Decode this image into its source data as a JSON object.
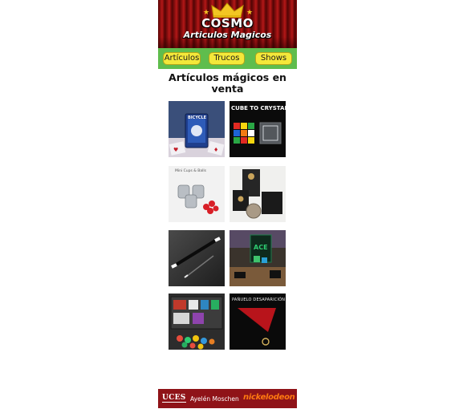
{
  "header": {
    "brand_title": "COSMO",
    "brand_subtitle": "Articulos Magicos",
    "crown_color": "#f3c623",
    "curtain_color": "#8e1010"
  },
  "nav": {
    "items": [
      {
        "label": "Artículos"
      },
      {
        "label": "Trucos"
      },
      {
        "label": "Shows"
      }
    ],
    "bar_color": "#5fbd4d",
    "button_color": "#f4e83a"
  },
  "main": {
    "heading": "Artículos mágicos en venta",
    "products": [
      {
        "name": "bicycle-deck-product",
        "caption": "BICYCLE",
        "icon": "playing-cards"
      },
      {
        "name": "cube-to-crystal-product",
        "caption": "CUBE TO CRYSTAL",
        "icon": "rubiks-cube"
      },
      {
        "name": "cups-and-balls-product",
        "caption": "Mini Cups & Balls",
        "icon": "cups-balls"
      },
      {
        "name": "coin-trick-product",
        "caption": "",
        "icon": "coin-box"
      },
      {
        "name": "magic-wand-product",
        "caption": "",
        "icon": "wand"
      },
      {
        "name": "dice-trick-product",
        "caption": "",
        "icon": "dice-box"
      },
      {
        "name": "magic-kit-product",
        "caption": "",
        "icon": "magic-kit"
      },
      {
        "name": "vanishing-handkerchief-product",
        "caption": "PAÑUELO DESAPARICIÓN",
        "icon": "red-handkerchief"
      }
    ]
  },
  "footer": {
    "university": "UCES",
    "author": "Ayelén Moschen",
    "brand": "nickelodeon",
    "bar_color": "#8f1318"
  }
}
